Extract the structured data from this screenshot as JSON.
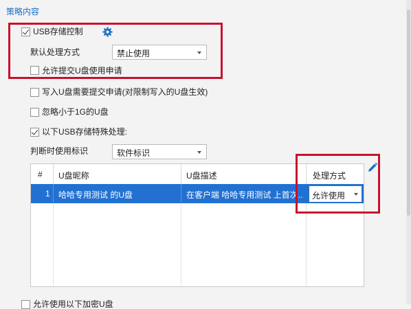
{
  "section_title": "策略内容",
  "usb_control": {
    "label": "USB存储控制",
    "checked": true
  },
  "default_handling": {
    "label": "默认处理方式",
    "value": "禁止使用"
  },
  "allow_apply": {
    "label": "允许提交U盘使用申请",
    "checked": false
  },
  "write_apply": {
    "label": "写入U盘需要提交申请(对限制写入的U盘生效)",
    "checked": false
  },
  "ignore_small": {
    "label": "忽略小于1G的U盘",
    "checked": false
  },
  "special_handling": {
    "label": "以下USB存储特殊处理:",
    "checked": true
  },
  "judge_flag": {
    "label": "判断时使用标识",
    "value": "软件标识"
  },
  "table": {
    "headers": {
      "num": "#",
      "nickname": "U盘昵称",
      "description": "U盘描述",
      "handling": "处理方式"
    },
    "rows": [
      {
        "num": "1",
        "nickname": "哈哈专用测试 的U盘",
        "description": "在客户端 哈哈专用测试 上首次...",
        "handling": "允许使用"
      }
    ]
  },
  "bottom_option": {
    "label": "允许使用以下加密U盘",
    "checked": false
  },
  "icons": {
    "gear": "gear-icon",
    "edit": "pencil-icon"
  },
  "colors": {
    "accent": "#1a6fc4",
    "highlight": "#2271d2",
    "annotation_red": "#c8102e"
  }
}
